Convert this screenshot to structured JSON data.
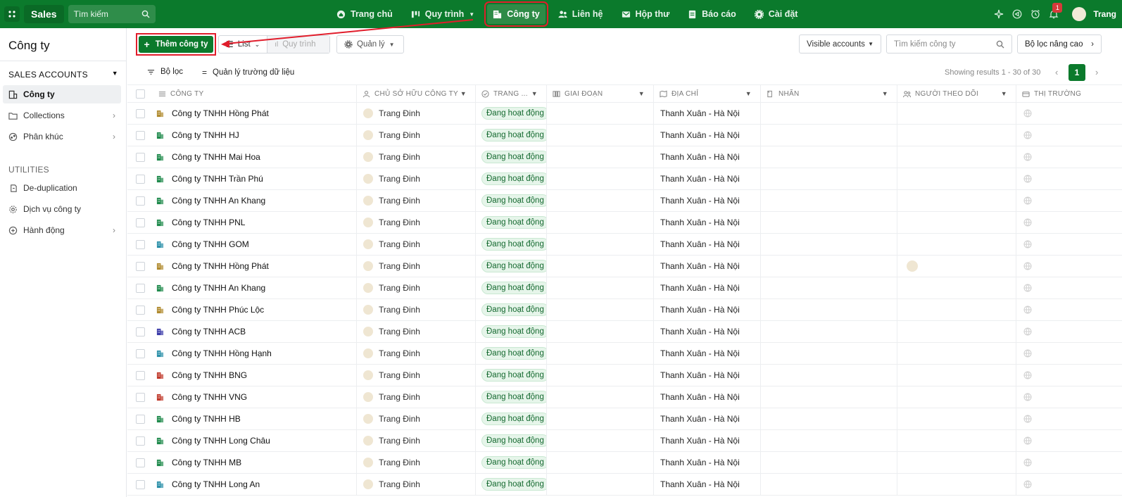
{
  "topbar": {
    "brand": "Sales",
    "search_label": "Tìm kiếm",
    "nav": [
      {
        "label": "Trang chủ",
        "icon": "home-icon"
      },
      {
        "label": "Quy trình",
        "icon": "pipeline-icon",
        "has_dropdown": true
      },
      {
        "label": "Công ty",
        "icon": "building-icon",
        "active": true
      },
      {
        "label": "Liên hệ",
        "icon": "contacts-icon"
      },
      {
        "label": "Hộp thư",
        "icon": "mail-icon"
      },
      {
        "label": "Báo cáo",
        "icon": "report-icon"
      },
      {
        "label": "Cài đặt",
        "icon": "gear-icon"
      }
    ],
    "notification_count": "1",
    "user_name": "Trang"
  },
  "sidebar": {
    "title": "Công ty",
    "section": "SALES ACCOUNTS",
    "items": [
      {
        "label": "Công ty",
        "active": true
      },
      {
        "label": "Collections"
      },
      {
        "label": "Phân khúc"
      }
    ],
    "utilities_title": "UTILITIES",
    "utilities": [
      {
        "label": "De-duplication"
      },
      {
        "label": "Dịch vụ công ty"
      },
      {
        "label": "Hành động"
      }
    ]
  },
  "toolbar": {
    "add_label": "Thêm công ty",
    "view_list": "List",
    "view_pipeline": "Quy trình",
    "manage_label": "Quản lý",
    "visible_select": "Visible accounts",
    "search_placeholder": "Tìm kiếm công ty",
    "advanced_filter": "Bộ lọc nâng cao"
  },
  "subbar": {
    "filter_label": "Bộ lọc",
    "fields_label": "Quản lý trường dữ liệu",
    "showing": "Showing results 1 - 30 of 30",
    "page": "1"
  },
  "table": {
    "columns": [
      "CÔNG TY",
      "CHỦ SỞ HỮU CÔNG TY",
      "TRANG ...",
      "GIAI ĐOẠN",
      "ĐỊA CHỈ",
      "NHÃN",
      "NGƯỜI THEO DÕI",
      "THỊ TRƯỜNG"
    ],
    "rows": [
      {
        "name": "Công ty TNHH Hồng Phát",
        "icon_color": "#b08a2e",
        "owner": "Trang Đinh",
        "status": "Đang hoạt động",
        "address": "Thanh Xuân - Hà Nội",
        "follower": false
      },
      {
        "name": "Công ty TNHH HJ",
        "icon_color": "#1f8a4c",
        "owner": "Trang Đinh",
        "status": "Đang hoạt động",
        "address": "Thanh Xuân - Hà Nội",
        "follower": false
      },
      {
        "name": "Công ty TNHH Mai Hoa",
        "icon_color": "#1f8a4c",
        "owner": "Trang Đinh",
        "status": "Đang hoạt động",
        "address": "Thanh Xuân - Hà Nội",
        "follower": false
      },
      {
        "name": "Công ty TNHH Trần Phú",
        "icon_color": "#1f8a4c",
        "owner": "Trang Đinh",
        "status": "Đang hoạt động",
        "address": "Thanh Xuân - Hà Nội",
        "follower": false
      },
      {
        "name": "Công ty TNHH An Khang",
        "icon_color": "#1f8a4c",
        "owner": "Trang Đinh",
        "status": "Đang hoạt động",
        "address": "Thanh Xuân - Hà Nội",
        "follower": false
      },
      {
        "name": "Công ty TNHH PNL",
        "icon_color": "#1f8a4c",
        "owner": "Trang Đinh",
        "status": "Đang hoạt động",
        "address": "Thanh Xuân - Hà Nội",
        "follower": false
      },
      {
        "name": "Công ty TNHH GOM",
        "icon_color": "#2a8fa8",
        "owner": "Trang Đinh",
        "status": "Đang hoạt động",
        "address": "Thanh Xuân - Hà Nội",
        "follower": false
      },
      {
        "name": "Công ty TNHH Hồng Phát",
        "icon_color": "#b08a2e",
        "owner": "Trang Đinh",
        "status": "Đang hoạt động",
        "address": "Thanh Xuân - Hà Nội",
        "follower": true
      },
      {
        "name": "Công ty TNHH An Khang",
        "icon_color": "#1f8a4c",
        "owner": "Trang Đinh",
        "status": "Đang hoạt động",
        "address": "Thanh Xuân - Hà Nội",
        "follower": false
      },
      {
        "name": "Công ty TNHH Phúc Lộc",
        "icon_color": "#b08a2e",
        "owner": "Trang Đinh",
        "status": "Đang hoạt động",
        "address": "Thanh Xuân - Hà Nội",
        "follower": false
      },
      {
        "name": "Công ty TNHH ACB",
        "icon_color": "#3a3aa8",
        "owner": "Trang Đinh",
        "status": "Đang hoạt động",
        "address": "Thanh Xuân - Hà Nội",
        "follower": false
      },
      {
        "name": "Công ty TNHH Hồng Hạnh",
        "icon_color": "#2a8fa8",
        "owner": "Trang Đinh",
        "status": "Đang hoạt động",
        "address": "Thanh Xuân - Hà Nội",
        "follower": false
      },
      {
        "name": "Công ty TNHH BNG",
        "icon_color": "#c0392b",
        "owner": "Trang Đinh",
        "status": "Đang hoạt động",
        "address": "Thanh Xuân - Hà Nội",
        "follower": false
      },
      {
        "name": "Công ty TNHH VNG",
        "icon_color": "#c0392b",
        "owner": "Trang Đinh",
        "status": "Đang hoạt động",
        "address": "Thanh Xuân - Hà Nội",
        "follower": false
      },
      {
        "name": "Công ty TNHH HB",
        "icon_color": "#1f8a4c",
        "owner": "Trang Đinh",
        "status": "Đang hoạt động",
        "address": "Thanh Xuân - Hà Nội",
        "follower": false
      },
      {
        "name": "Công ty TNHH Long Châu",
        "icon_color": "#1f8a4c",
        "owner": "Trang Đinh",
        "status": "Đang hoạt động",
        "address": "Thanh Xuân - Hà Nội",
        "follower": false
      },
      {
        "name": "Công ty TNHH MB",
        "icon_color": "#1f8a4c",
        "owner": "Trang Đinh",
        "status": "Đang hoạt động",
        "address": "Thanh Xuân - Hà Nội",
        "follower": false
      },
      {
        "name": "Công ty TNHH Long An",
        "icon_color": "#2a8fa8",
        "owner": "Trang Đinh",
        "status": "Đang hoạt động",
        "address": "Thanh Xuân - Hà Nội",
        "follower": false
      }
    ]
  },
  "colors": {
    "brand_green": "#0b7a2c",
    "highlight_red": "#e11d2b"
  }
}
